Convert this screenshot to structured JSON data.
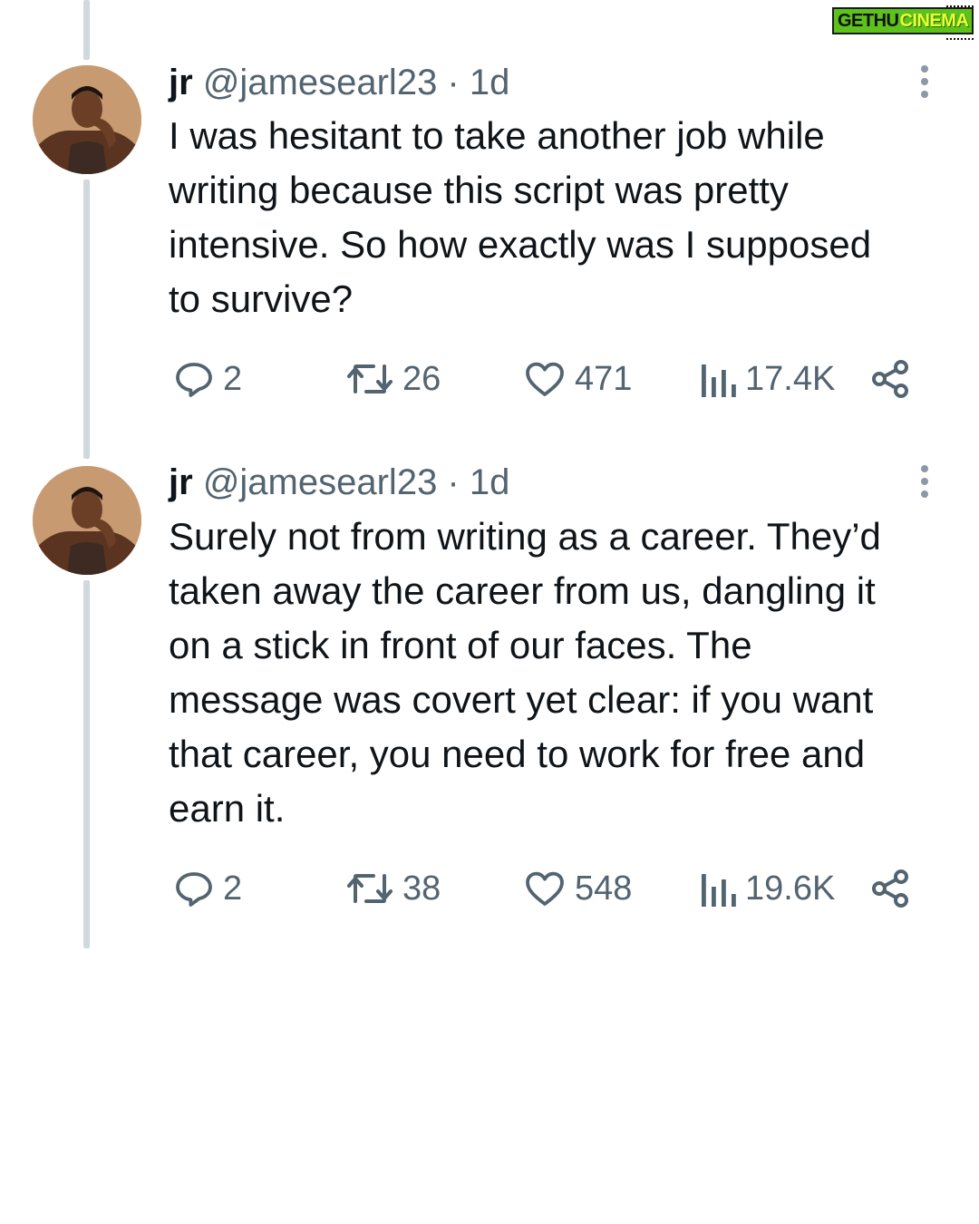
{
  "watermark": {
    "part1": "GETHU",
    "part2": "CINEMA"
  },
  "tweets": [
    {
      "name": "jr",
      "handle": "@jamesearl23",
      "separator": " · ",
      "time": "1d",
      "text": "I was hesitant to take another job while\nwriting because this script was pretty\nintensive. So how exactly was I supposed\nto survive?",
      "replies": "2",
      "reposts": "26",
      "likes": "471",
      "views": "17.4K"
    },
    {
      "name": "jr",
      "handle": "@jamesearl23",
      "separator": " · ",
      "time": "1d",
      "text": "Surely not from writing as a career. They’d\ntaken away the career from us, dangling it\non a stick in front of our faces. The\nmessage was covert yet clear: if you want\nthat career, you need to work for free and\nearn it.",
      "replies": "2",
      "reposts": "38",
      "likes": "548",
      "views": "19.6K"
    }
  ],
  "icons": {
    "reply": "reply-icon",
    "repost": "repost-icon",
    "like": "like-icon",
    "views": "views-icon",
    "share": "share-icon",
    "more": "more-icon"
  },
  "colors": {
    "text": "#0f1419",
    "secondary": "#536471",
    "thread_line": "#cfd9de",
    "watermark_bg": "#5ec21c"
  }
}
